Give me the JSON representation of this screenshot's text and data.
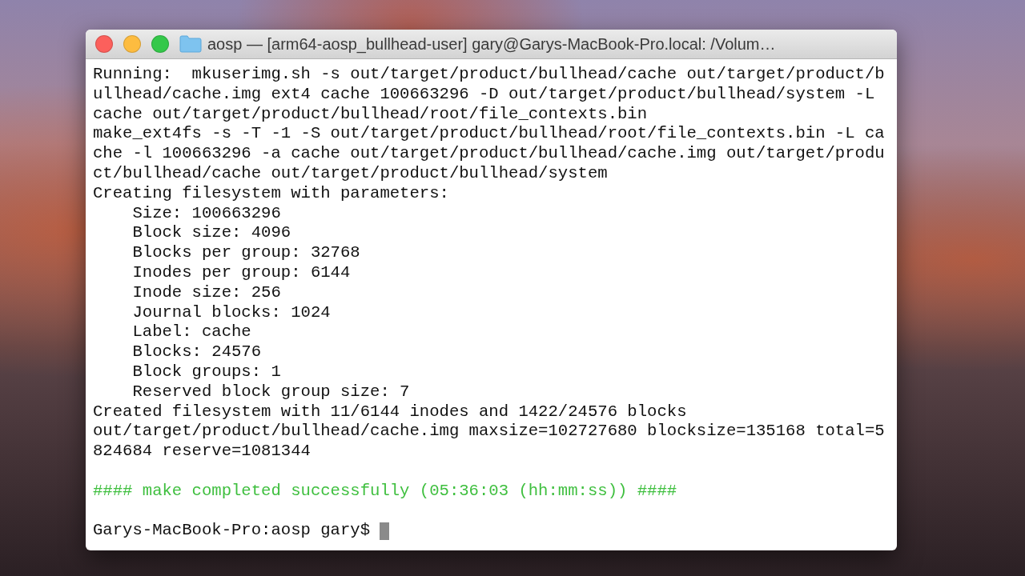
{
  "window": {
    "title": "aosp — [arm64-aosp_bullhead-user] gary@Garys-MacBook-Pro.local: /Volum…"
  },
  "terminal": {
    "lines": [
      {
        "kind": "output",
        "text": "Running:  mkuserimg.sh -s out/target/product/bullhead/cache out/target/product/b"
      },
      {
        "kind": "output",
        "text": "ullhead/cache.img ext4 cache 100663296 -D out/target/product/bullhead/system -L"
      },
      {
        "kind": "output",
        "text": "cache out/target/product/bullhead/root/file_contexts.bin"
      },
      {
        "kind": "output",
        "text": "make_ext4fs -s -T -1 -S out/target/product/bullhead/root/file_contexts.bin -L ca"
      },
      {
        "kind": "output",
        "text": "che -l 100663296 -a cache out/target/product/bullhead/cache.img out/target/produ"
      },
      {
        "kind": "output",
        "text": "ct/bullhead/cache out/target/product/bullhead/system"
      },
      {
        "kind": "output",
        "text": "Creating filesystem with parameters:"
      },
      {
        "kind": "output",
        "text": "    Size: 100663296"
      },
      {
        "kind": "output",
        "text": "    Block size: 4096"
      },
      {
        "kind": "output",
        "text": "    Blocks per group: 32768"
      },
      {
        "kind": "output",
        "text": "    Inodes per group: 6144"
      },
      {
        "kind": "output",
        "text": "    Inode size: 256"
      },
      {
        "kind": "output",
        "text": "    Journal blocks: 1024"
      },
      {
        "kind": "output",
        "text": "    Label: cache"
      },
      {
        "kind": "output",
        "text": "    Blocks: 24576"
      },
      {
        "kind": "output",
        "text": "    Block groups: 1"
      },
      {
        "kind": "output",
        "text": "    Reserved block group size: 7"
      },
      {
        "kind": "output",
        "text": "Created filesystem with 11/6144 inodes and 1422/24576 blocks"
      },
      {
        "kind": "output",
        "text": "out/target/product/bullhead/cache.img maxsize=102727680 blocksize=135168 total=5"
      },
      {
        "kind": "output",
        "text": "824684 reserve=1081344"
      },
      {
        "kind": "blank"
      },
      {
        "kind": "success",
        "text": "#### make completed successfully (05:36:03 (hh:mm:ss)) ####"
      },
      {
        "kind": "blank"
      },
      {
        "kind": "prompt",
        "text": "Garys-MacBook-Pro:aosp gary$",
        "cursor": true
      }
    ]
  }
}
